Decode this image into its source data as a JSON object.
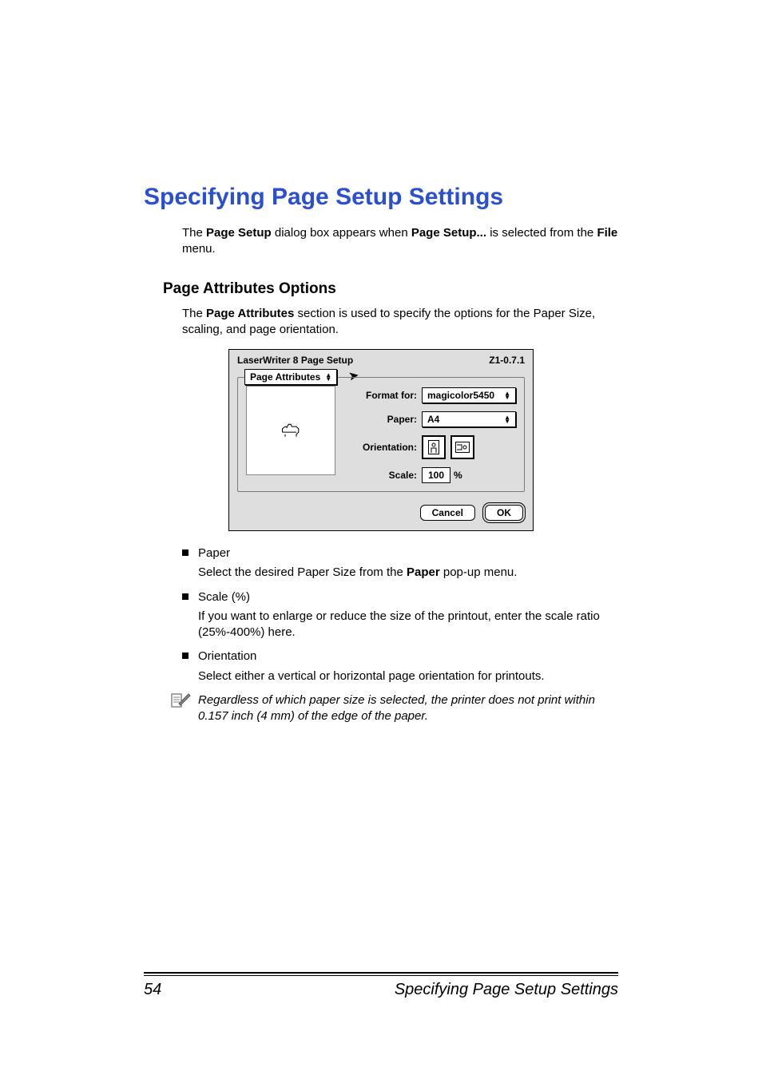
{
  "heading": "Specifying Page Setup Settings",
  "intro": {
    "prefix": "The ",
    "bold1": "Page Setup",
    "mid1": " dialog box appears when ",
    "bold2": "Page Setup...",
    "mid2": " is selected from the ",
    "bold3": "File",
    "suffix": " menu."
  },
  "subheading": "Page Attributes Options",
  "subintro": {
    "prefix": "The ",
    "bold": "Page Attributes",
    "suffix": " section is used to specify the options for the Paper Size, scaling, and page orientation."
  },
  "dialog": {
    "title": "LaserWriter 8 Page Setup",
    "version": "Z1-0.7.1",
    "section_popup": "Page Attributes",
    "format_for_label": "Format for:",
    "format_for_value": "magicolor5450",
    "paper_label": "Paper:",
    "paper_value": "A4",
    "orientation_label": "Orientation:",
    "scale_label": "Scale:",
    "scale_value": "100",
    "scale_suffix": "%",
    "cancel": "Cancel",
    "ok": "OK"
  },
  "bullets": {
    "paper_title": "Paper",
    "paper_desc_pre": "Select the desired Paper Size from the ",
    "paper_desc_bold": "Paper",
    "paper_desc_post": " pop-up menu.",
    "scale_title": "Scale (%)",
    "scale_desc": "If you want to enlarge or reduce the size of the printout, enter the scale ratio (25%-400%) here.",
    "orient_title": "Orientation",
    "orient_desc": "Select either a vertical or horizontal page orientation for printouts."
  },
  "note": "Regardless of which paper size is selected, the printer does not print within 0.157 inch (4 mm) of the edge of the paper.",
  "footer": {
    "page_number": "54",
    "running_title": "Specifying Page Setup Settings"
  }
}
